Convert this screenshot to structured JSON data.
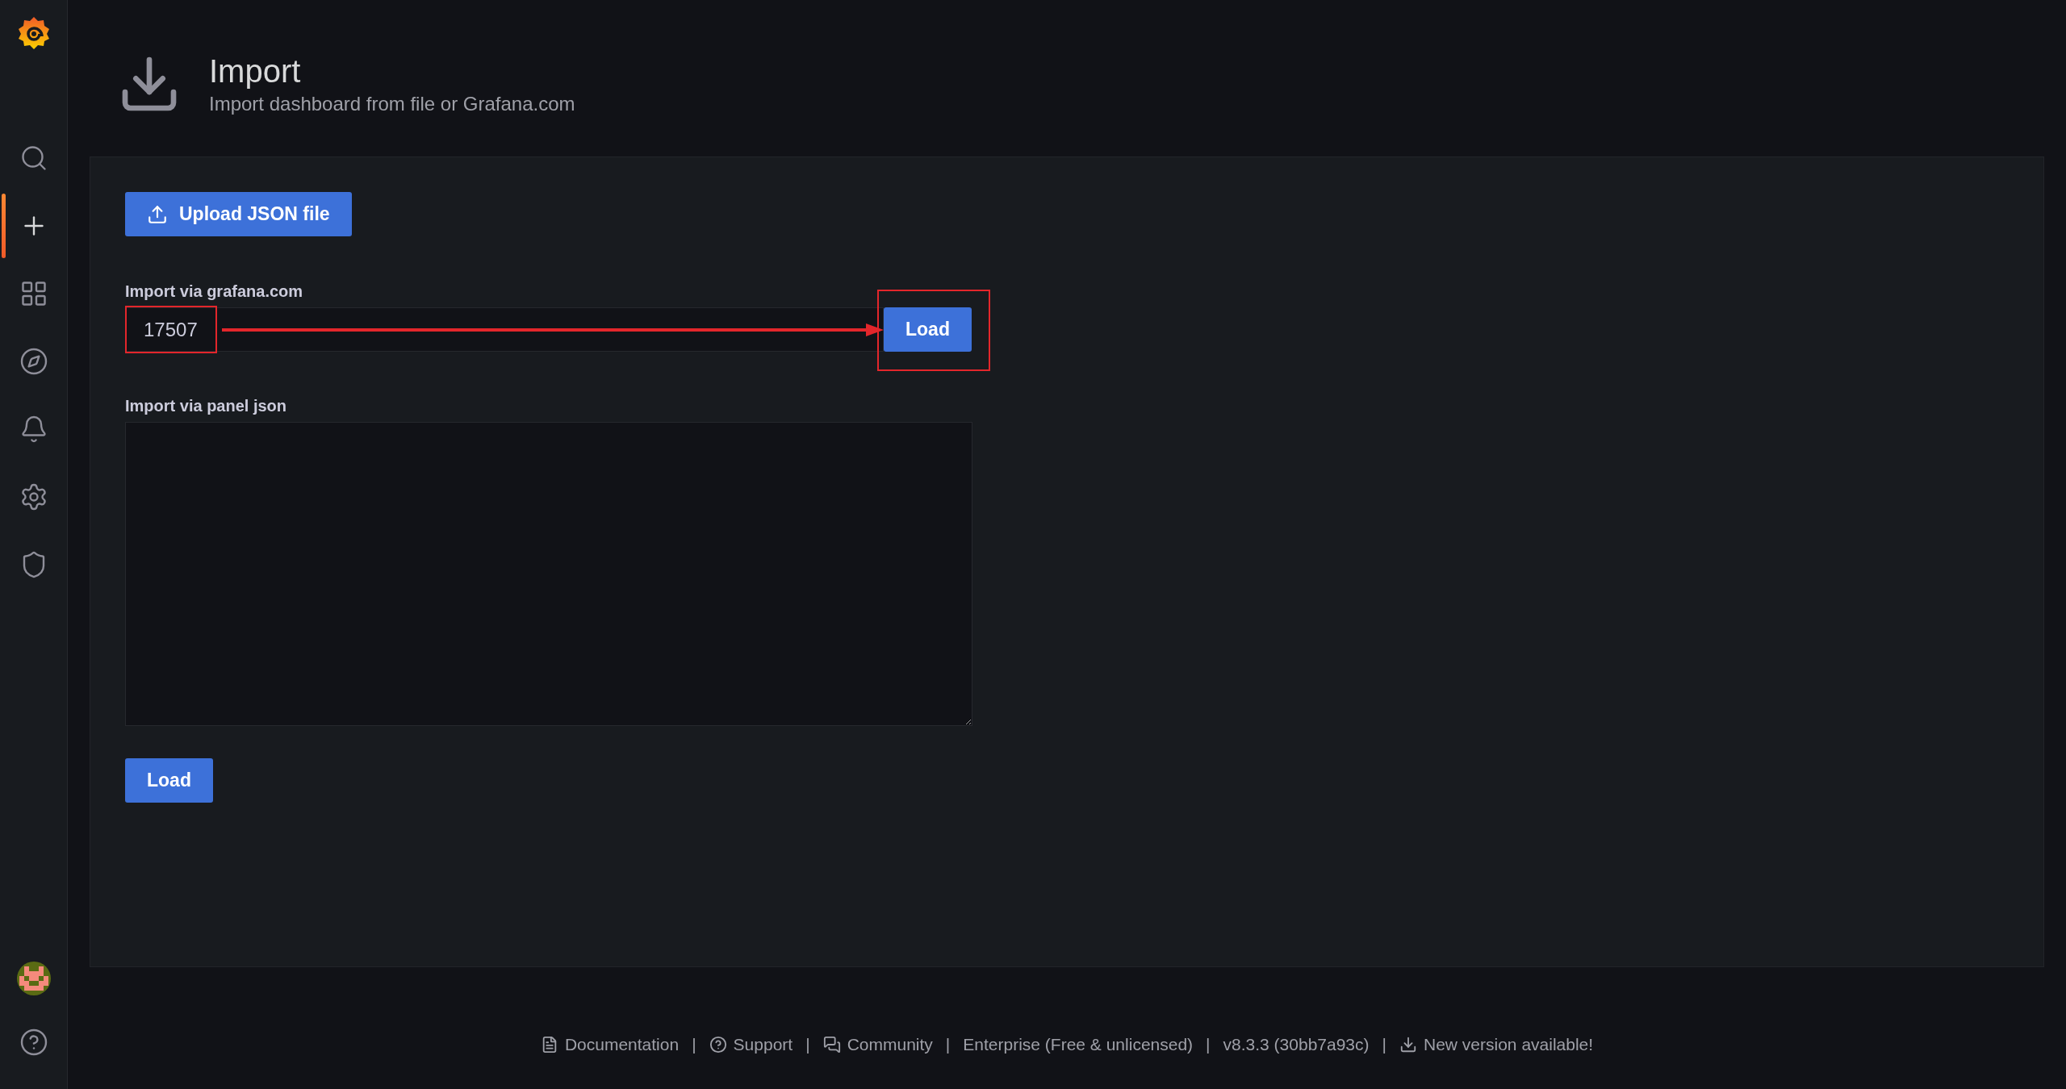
{
  "sidebar": {
    "items": [
      {
        "kind": "search",
        "selected": false
      },
      {
        "kind": "create",
        "selected": true
      },
      {
        "kind": "dashboards",
        "selected": false
      },
      {
        "kind": "explore",
        "selected": false
      },
      {
        "kind": "alerting",
        "selected": false
      },
      {
        "kind": "configuration",
        "selected": false
      },
      {
        "kind": "admin",
        "selected": false
      }
    ]
  },
  "header": {
    "title": "Import",
    "subtitle": "Import dashboard from file or Grafana.com"
  },
  "upload_button": "Upload JSON file",
  "grafana_com": {
    "label": "Import via grafana.com",
    "value": "17507",
    "button": "Load"
  },
  "panel_json": {
    "label": "Import via panel json",
    "button": "Load"
  },
  "footer": [
    {
      "kind": "doc",
      "text": "Documentation"
    },
    {
      "kind": "separator",
      "text": "|"
    },
    {
      "kind": "help",
      "text": "Support"
    },
    {
      "kind": "separator",
      "text": "|"
    },
    {
      "kind": "chat",
      "text": "Community"
    },
    {
      "kind": "separator",
      "text": "|"
    },
    {
      "kind": "plain",
      "text": "Enterprise (Free & unlicensed)"
    },
    {
      "kind": "separator",
      "text": "|"
    },
    {
      "kind": "plain",
      "text": "v8.3.3 (30bb7a93c)"
    },
    {
      "kind": "separator",
      "text": "|"
    },
    {
      "kind": "download",
      "text": "New version available!"
    }
  ]
}
